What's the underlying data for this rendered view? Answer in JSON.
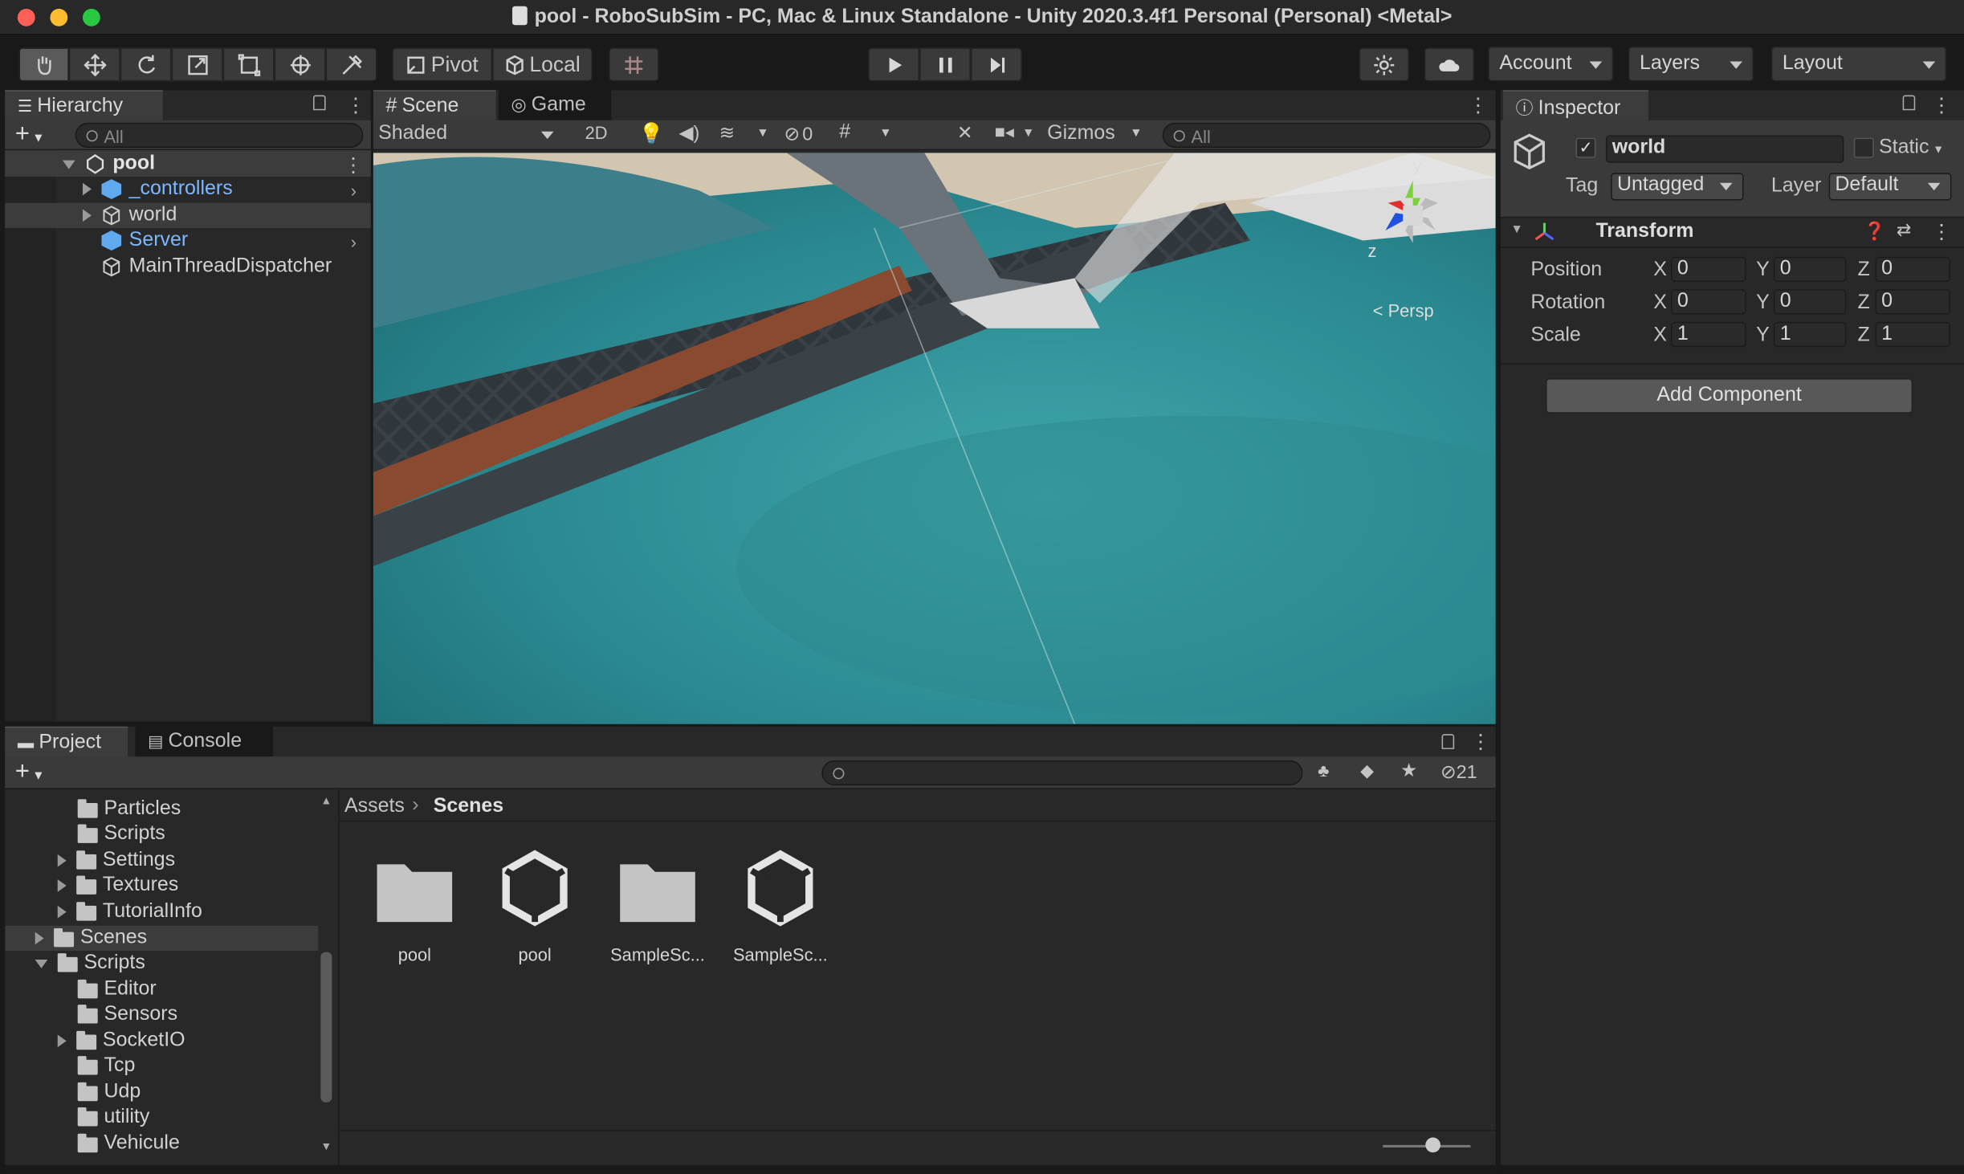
{
  "window": {
    "title": "pool - RoboSubSim - PC, Mac & Linux Standalone - Unity 2020.3.4f1 Personal (Personal) <Metal>"
  },
  "toolbar": {
    "pivot": "Pivot",
    "local": "Local",
    "account": "Account",
    "layers": "Layers",
    "layout": "Layout"
  },
  "hierarchy": {
    "tab": "Hierarchy",
    "search_placeholder": "All",
    "scene": "pool",
    "items": [
      {
        "label": "_controllers",
        "color": "#7bb8ff"
      },
      {
        "label": "world",
        "color": "#d2d2d2"
      },
      {
        "label": "Server",
        "color": "#7bb8ff"
      },
      {
        "label": "MainThreadDispatcher",
        "color": "#d2d2d2"
      }
    ]
  },
  "scene": {
    "tabs": [
      "Scene",
      "Game"
    ],
    "shading": "Shaded",
    "mode_2d": "2D",
    "hidden_count": "0",
    "gizmos": "Gizmos",
    "search_placeholder": "All",
    "gizmo_y": "y",
    "gizmo_x": "x",
    "gizmo_z": "z",
    "persp": "< Persp"
  },
  "inspector": {
    "tab": "Inspector",
    "object_name": "world",
    "static_label": "Static",
    "tag_label": "Tag",
    "tag_value": "Untagged",
    "layer_label": "Layer",
    "layer_value": "Default",
    "transform_title": "Transform",
    "rows": [
      {
        "label": "Position",
        "x": "0",
        "y": "0",
        "z": "0"
      },
      {
        "label": "Rotation",
        "x": "0",
        "y": "0",
        "z": "0"
      },
      {
        "label": "Scale",
        "x": "1",
        "y": "1",
        "z": "1"
      }
    ],
    "axis_x": "X",
    "axis_y": "Y",
    "axis_z": "Z",
    "add_component": "Add Component"
  },
  "project": {
    "tabs": [
      "Project",
      "Console"
    ],
    "hidden_count": "21",
    "breadcrumb_root": "Assets",
    "breadcrumb_current": "Scenes",
    "tree": [
      {
        "label": "Particles"
      },
      {
        "label": "Scripts"
      },
      {
        "label": "Settings"
      },
      {
        "label": "Textures"
      },
      {
        "label": "TutorialInfo"
      },
      {
        "label": "Scenes"
      },
      {
        "label": "Scripts"
      },
      {
        "label": "Editor"
      },
      {
        "label": "Sensors"
      },
      {
        "label": "SocketIO"
      },
      {
        "label": "Tcp"
      },
      {
        "label": "Udp"
      },
      {
        "label": "utility"
      },
      {
        "label": "Vehicule"
      }
    ],
    "assets": [
      {
        "label": "pool",
        "kind": "folder"
      },
      {
        "label": "pool",
        "kind": "unity-scene"
      },
      {
        "label": "SampleSc...",
        "kind": "folder"
      },
      {
        "label": "SampleSc...",
        "kind": "unity-scene"
      }
    ]
  }
}
